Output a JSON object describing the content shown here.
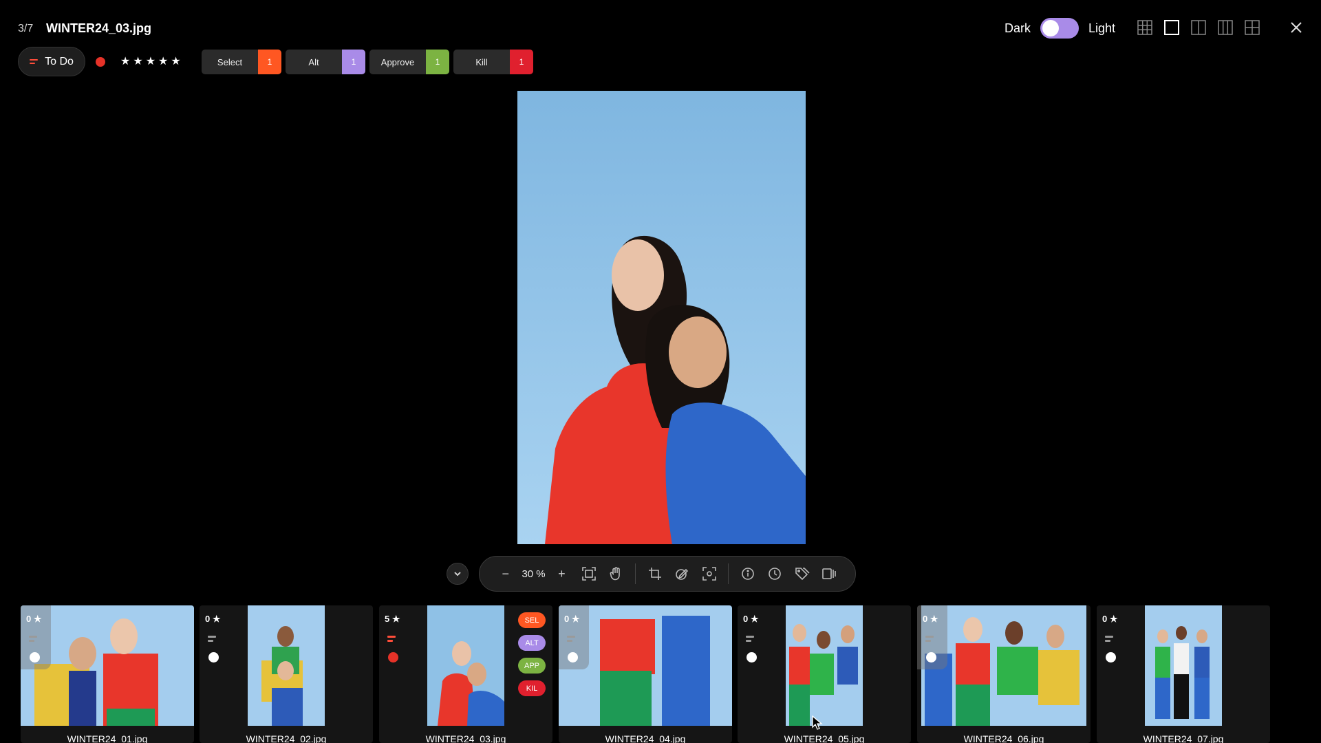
{
  "header": {
    "counter": "3/7",
    "filename": "WINTER24_03.jpg",
    "theme": {
      "dark_label": "Dark",
      "light_label": "Light",
      "toggle_color": "#a98be8"
    },
    "layout_icons": [
      "grid-3x3-icon",
      "single-view-icon",
      "split-2-icon",
      "split-3-icon",
      "grid-2x2-icon"
    ],
    "close_icon": "close-icon"
  },
  "status": {
    "label": "To Do",
    "color_dot": "#e63228",
    "stars": [
      "★",
      "★",
      "★",
      "★",
      "★"
    ]
  },
  "tags": [
    {
      "label": "Select",
      "count": "1",
      "color": "#ff5722"
    },
    {
      "label": "Alt",
      "count": "1",
      "color": "#a98be8"
    },
    {
      "label": "Approve",
      "count": "1",
      "color": "#7cb342"
    },
    {
      "label": "Kill",
      "count": "1",
      "color": "#e0202e"
    }
  ],
  "toolbar": {
    "zoom_out": "−",
    "zoom": "30 %",
    "zoom_in": "+",
    "icons": [
      "fit-screen-icon",
      "hand-pan-icon",
      "crop-icon",
      "draw-icon",
      "focus-icon",
      "info-icon",
      "clock-icon",
      "tags-icon",
      "compare-icon"
    ]
  },
  "filmstrip": [
    {
      "name": "WINTER24_01.jpg",
      "rating": "0 ★"
    },
    {
      "name": "WINTER24_02.jpg",
      "rating": "0 ★"
    },
    {
      "name": "WINTER24_03.jpg",
      "rating": "5 ★",
      "pills": [
        "SEL",
        "ALT",
        "APP",
        "KIL"
      ]
    },
    {
      "name": "WINTER24_04.jpg",
      "rating": "0 ★"
    },
    {
      "name": "WINTER24_05.jpg",
      "rating": "0 ★"
    },
    {
      "name": "WINTER24_06.jpg",
      "rating": "0 ★"
    },
    {
      "name": "WINTER24_07.jpg",
      "rating": "0 ★"
    }
  ]
}
